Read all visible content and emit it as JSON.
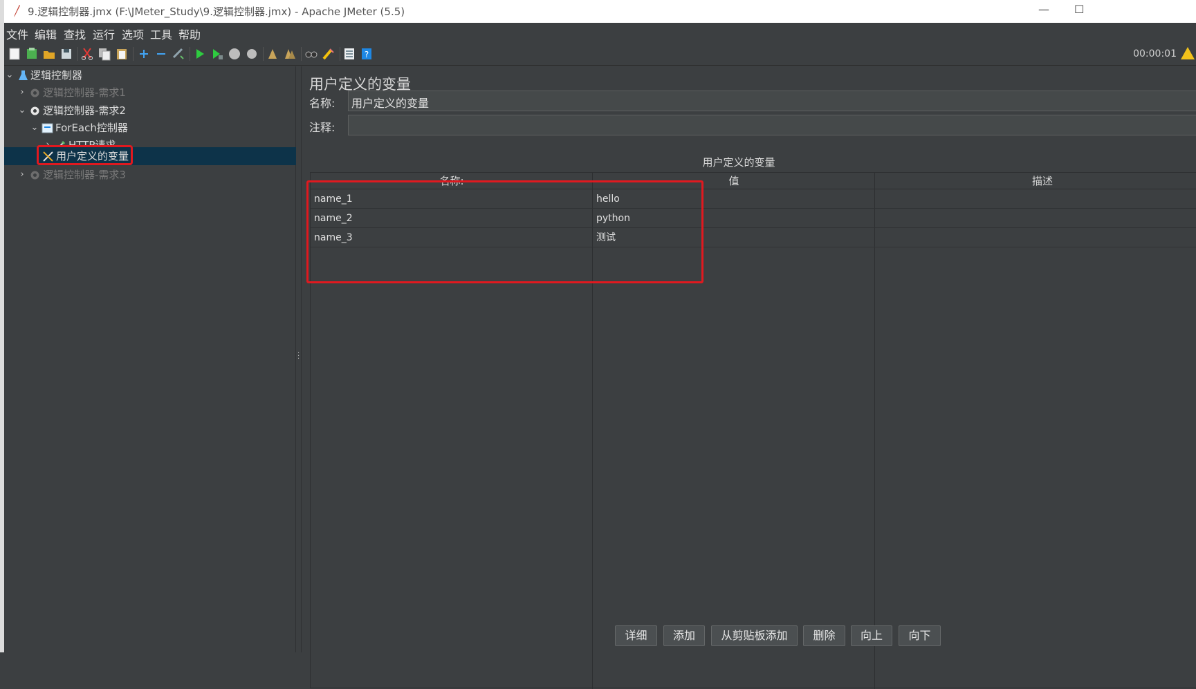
{
  "window": {
    "title": "9.逻辑控制器.jmx (F:\\JMeter_Study\\9.逻辑控制器.jmx) - Apache JMeter (5.5)",
    "minimize": "—",
    "maximize": "☐"
  },
  "menu": [
    "文件",
    "编辑",
    "查找",
    "运行",
    "选项",
    "工具",
    "帮助"
  ],
  "toolbar": {
    "icons": [
      "new-icon",
      "templates-icon",
      "open-icon",
      "save-icon",
      "cut-icon",
      "copy-icon",
      "paste-icon",
      "expand-icon",
      "collapse-icon",
      "toggle-icon",
      "start-icon",
      "start-no-pause-icon",
      "stop-icon",
      "shutdown-icon",
      "clear-icon",
      "clear-all-icon",
      "search-icon",
      "reset-search-icon",
      "function-helper-icon",
      "help-icon"
    ],
    "timer": "00:00:01"
  },
  "tree": {
    "root": "逻辑控制器",
    "items": [
      {
        "label": "逻辑控制器-需求1",
        "disabled": true,
        "expanded": false
      },
      {
        "label": "逻辑控制器-需求2",
        "disabled": false,
        "expanded": true
      },
      {
        "label": "ForEach控制器",
        "disabled": false,
        "expanded": true
      },
      {
        "label": "HTTP请求",
        "disabled": false,
        "expanded": false
      },
      {
        "label": "用户定义的变量",
        "disabled": false,
        "selected": true
      },
      {
        "label": "逻辑控制器-需求3",
        "disabled": true,
        "expanded": false
      }
    ]
  },
  "panel": {
    "title": "用户定义的变量",
    "name_label": "名称:",
    "name_value": "用户定义的变量",
    "comment_label": "注释:",
    "comment_value": "",
    "table_caption": "用户定义的变量",
    "columns": [
      "名称:",
      "值",
      "描述"
    ],
    "rows": [
      {
        "name": "name_1",
        "value": "hello",
        "desc": ""
      },
      {
        "name": "name_2",
        "value": "python",
        "desc": ""
      },
      {
        "name": "name_3",
        "value": "测试",
        "desc": ""
      }
    ]
  },
  "buttons": [
    "详细",
    "添加",
    "从剪贴板添加",
    "删除",
    "向上",
    "向下"
  ],
  "colors": {
    "accent_red": "#e0191f",
    "selected_bg": "#0d3349",
    "background": "#3c3f41"
  }
}
